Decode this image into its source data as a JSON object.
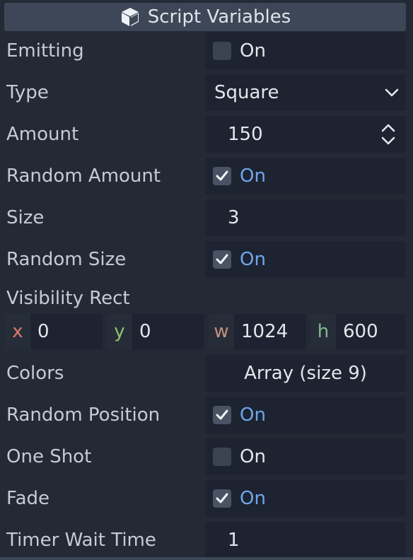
{
  "header": {
    "title": "Script Variables",
    "icon": "script-cube-icon"
  },
  "colors": {
    "background": "#232a36",
    "field_bg": "#1d2330",
    "header_bg": "#3e4757",
    "on_text": "#6fa6ec",
    "axis_x": "#d87a6a",
    "axis_y": "#8fc46a",
    "axis_w": "#c58f7b",
    "axis_h": "#7fb88f"
  },
  "properties": {
    "emitting": {
      "label": "Emitting",
      "checked": false,
      "text": "On"
    },
    "type": {
      "label": "Type",
      "value": "Square",
      "icon": "chevron-down-icon"
    },
    "amount": {
      "label": "Amount",
      "value": "150",
      "icon": "updown-spinner-icon"
    },
    "random_amount": {
      "label": "Random Amount",
      "checked": true,
      "text": "On"
    },
    "size": {
      "label": "Size",
      "value": "3"
    },
    "random_size": {
      "label": "Random Size",
      "checked": true,
      "text": "On"
    },
    "visibility_rect": {
      "label": "Visibility Rect",
      "x": {
        "axis": "x",
        "value": "0"
      },
      "y": {
        "axis": "y",
        "value": "0"
      },
      "w": {
        "axis": "w",
        "value": "1024"
      },
      "h": {
        "axis": "h",
        "value": "600"
      }
    },
    "colors": {
      "label": "Colors",
      "value": "Array (size 9)"
    },
    "random_position": {
      "label": "Random Position",
      "checked": true,
      "text": "On"
    },
    "one_shot": {
      "label": "One Shot",
      "checked": false,
      "text": "On"
    },
    "fade": {
      "label": "Fade",
      "checked": true,
      "text": "On"
    },
    "timer_wait_time": {
      "label": "Timer Wait Time",
      "value": "1"
    }
  }
}
